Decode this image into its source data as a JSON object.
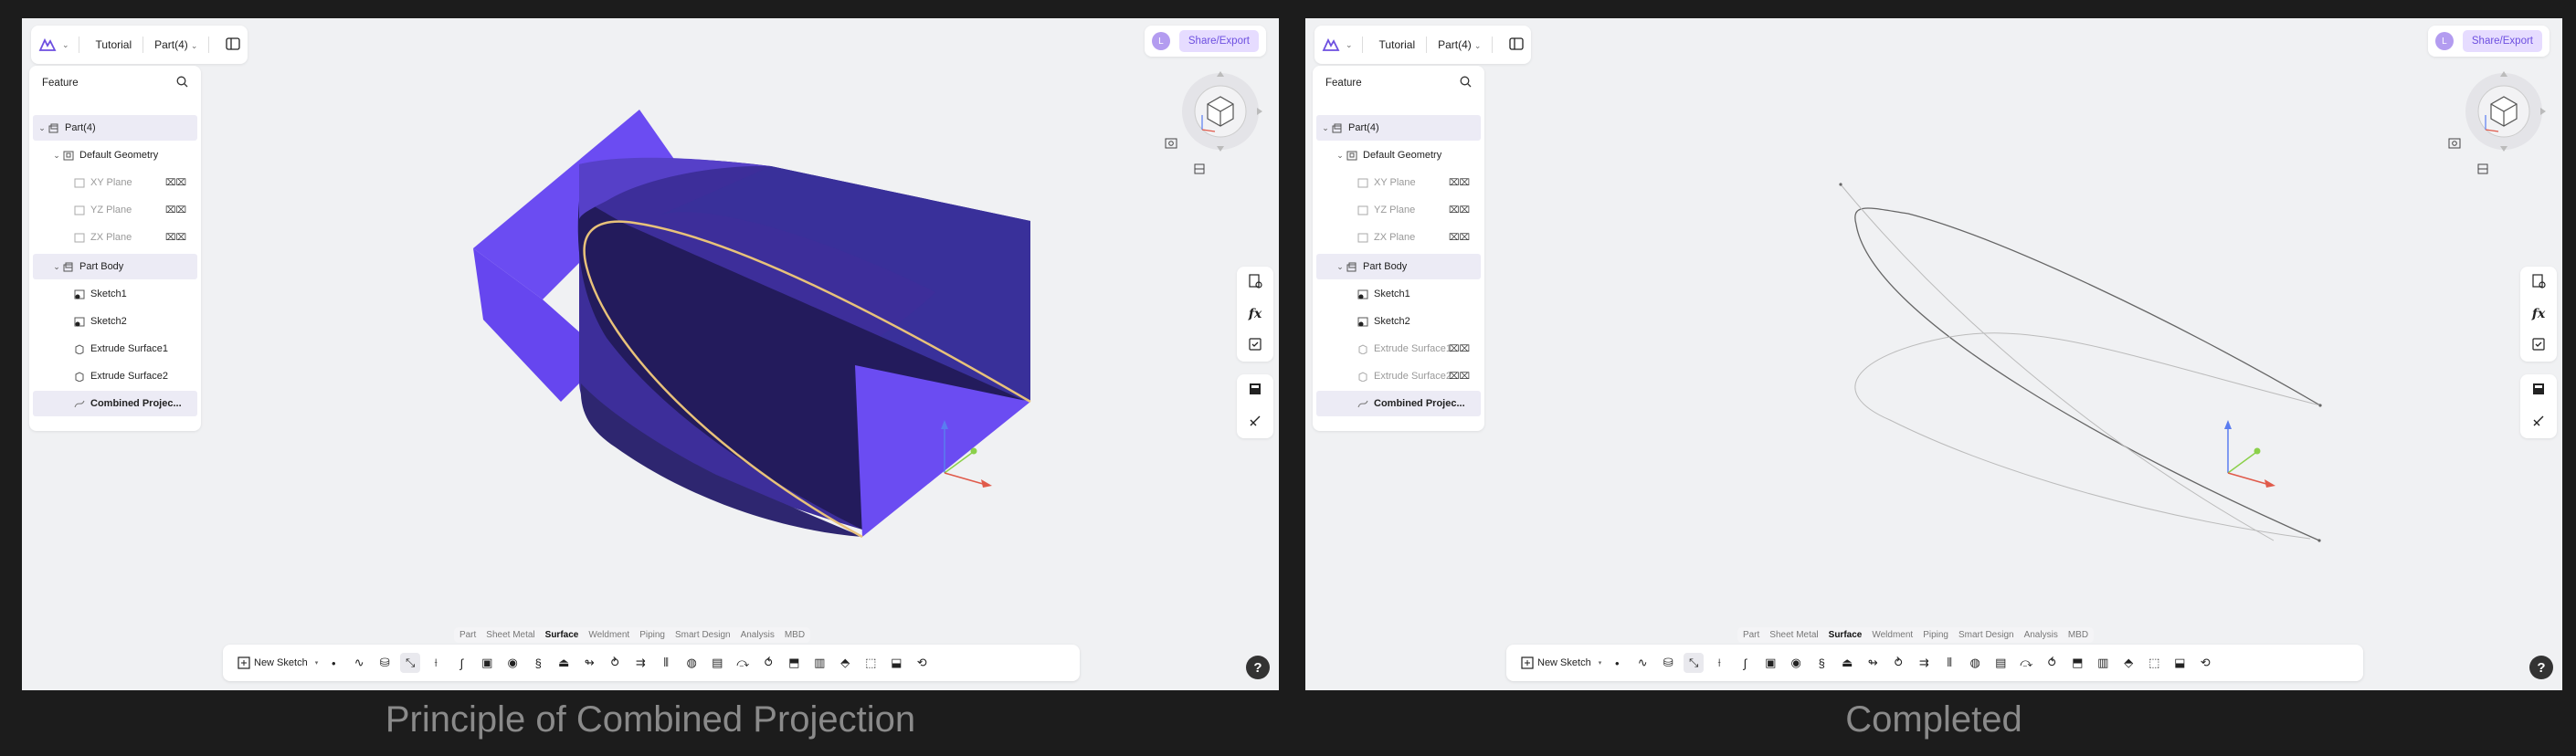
{
  "header": {
    "tutorial_label": "Tutorial",
    "part_label": "Part(4)",
    "share_label": "Share/Export",
    "avatar_initial": "L"
  },
  "feature_panel": {
    "title": "Feature",
    "items": [
      {
        "label": "Part(4)"
      },
      {
        "label": "Default Geometry"
      },
      {
        "label": "XY Plane"
      },
      {
        "label": "YZ Plane"
      },
      {
        "label": "ZX Plane"
      },
      {
        "label": "Part Body"
      },
      {
        "label": "Sketch1"
      },
      {
        "label": "Sketch2"
      },
      {
        "label": "Extrude Surface1"
      },
      {
        "label": "Extrude Surface2"
      },
      {
        "label": "Combined Projec..."
      }
    ]
  },
  "tabs": [
    "Part",
    "Sheet Metal",
    "Surface",
    "Weldment",
    "Piping",
    "Smart Design",
    "Analysis",
    "MBD"
  ],
  "active_tab": "Surface",
  "toolbar": {
    "new_sketch_label": "New Sketch"
  },
  "help_label": "?",
  "captions": {
    "left": "Principle of Combined Projection",
    "right": "Completed"
  },
  "colors": {
    "surface_light": "#6b4cf2",
    "surface_dark": "#2e2670",
    "highlight_curve": "#e8c27a",
    "accent": "#6d4fe0"
  },
  "icons": {
    "logo": "app-logo-icon",
    "search": "search-icon",
    "eye": "eye-hidden-icon",
    "help": "help-icon"
  }
}
